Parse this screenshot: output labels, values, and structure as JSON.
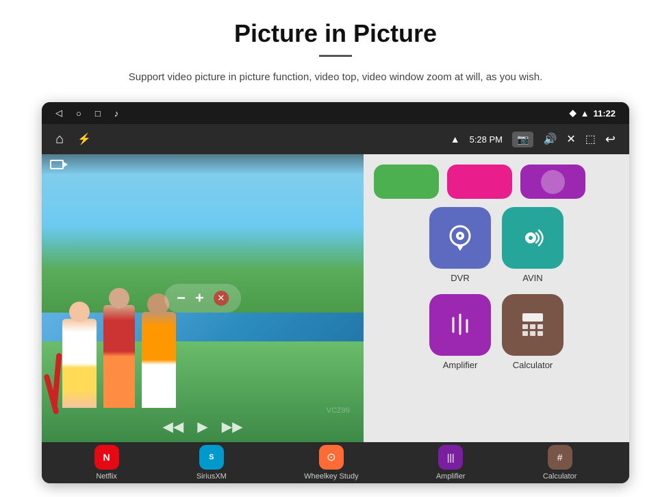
{
  "header": {
    "title": "Picture in Picture",
    "subtitle": "Support video picture in picture function, video top, video window zoom at will, as you wish."
  },
  "statusBar": {
    "time": "11:22",
    "icons": [
      "back-arrow",
      "home-circle",
      "square",
      "music-note",
      "location-pin",
      "wifi-signal"
    ]
  },
  "toolbar": {
    "time": "5:28 PM",
    "icons": [
      "home",
      "usb",
      "camera",
      "volume",
      "close-x",
      "pip-window",
      "back-arrow"
    ]
  },
  "pip": {
    "controls": {
      "minus": "−",
      "plus": "+",
      "close": "✕"
    },
    "bottomControls": {
      "prev": "◀",
      "play": "▶",
      "next": "▶▶"
    }
  },
  "apps": {
    "row1": [
      {
        "id": "dvr",
        "label": "DVR",
        "color": "#5c6bc0"
      },
      {
        "id": "avin",
        "label": "AVIN",
        "color": "#26a69a"
      }
    ],
    "row2": [
      {
        "id": "amplifier",
        "label": "Amplifier",
        "color": "#9c27b0"
      },
      {
        "id": "calculator",
        "label": "Calculator",
        "color": "#795548"
      }
    ]
  },
  "topApps": [
    {
      "label": "",
      "color": "#4caf50"
    },
    {
      "label": "",
      "color": "#e91e8c"
    },
    {
      "label": "",
      "color": "#9c27b0"
    }
  ],
  "bottomBar": [
    {
      "id": "netflix",
      "label": "Netflix",
      "color": "#e50914"
    },
    {
      "id": "siriusxm",
      "label": "SiriusXM",
      "color": "#0099cc"
    },
    {
      "id": "wheelkey",
      "label": "Wheelkey Study",
      "color": "#ff6b35"
    },
    {
      "id": "amplifier-bottom",
      "label": "Amplifier",
      "color": "#9c27b0"
    },
    {
      "id": "calculator-bottom",
      "label": "Calculator",
      "color": "#795548"
    }
  ],
  "watermark": "VCZ99"
}
